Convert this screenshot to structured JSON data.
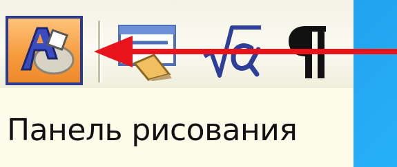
{
  "toolbar": {
    "buttons": [
      {
        "icon": "drawing-icon",
        "state": "pressed"
      },
      {
        "icon": "text-box-icon"
      },
      {
        "icon": "equation-icon"
      },
      {
        "icon": "pilcrow-icon"
      }
    ]
  },
  "caption": {
    "text": "Панель рисования"
  },
  "colors": {
    "background": "#1e9cec",
    "arrow": "#e8141c",
    "panel": "#fdfbe9",
    "pressed_border": "#2b3a8a"
  }
}
